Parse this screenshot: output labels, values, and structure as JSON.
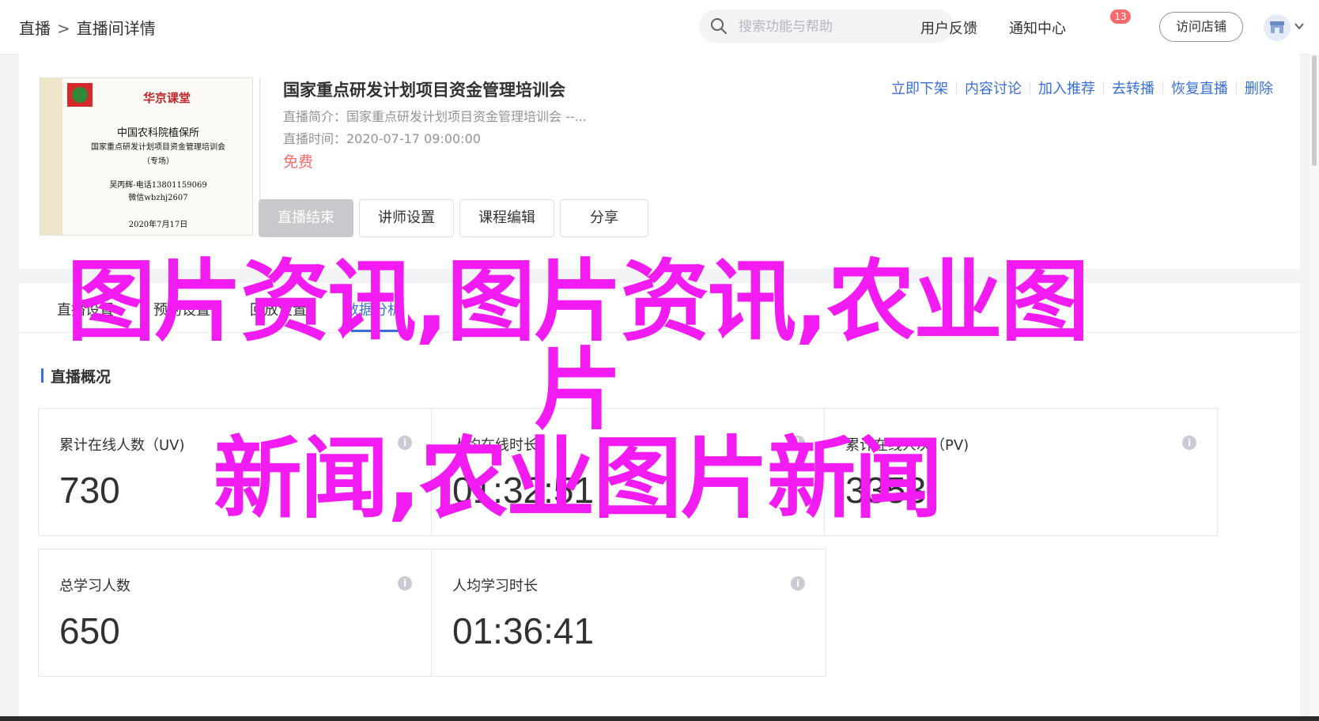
{
  "header": {
    "breadcrumb": [
      "直播",
      ">",
      "直播间详情"
    ],
    "search_placeholder": "搜索功能与帮助",
    "links": {
      "feedback": "用户反馈",
      "notifications": "通知中心",
      "notification_count": "13"
    },
    "visit_store": "访问店铺"
  },
  "course": {
    "cover": {
      "brand": "华京课堂",
      "org": "中国农科院植保所",
      "topic": "国家重点研发计划项目资金管理培训会",
      "kind": "（专场）",
      "contact1": "吴丙辉-电话13801159069",
      "contact2": "微信wbzhj2607",
      "date": "2020年7月17日"
    },
    "title": "国家重点研发计划项目资金管理培训会",
    "summary": "直播简介：国家重点研发计划项目资金管理培训会 --...",
    "time": "直播时间：2020-07-17 09:00:00",
    "price": "免费",
    "buttons": [
      "直播结束",
      "讲师设置",
      "课程编辑",
      "分享"
    ],
    "actions": [
      "立即下架",
      "内容讨论",
      "加入推荐",
      "去转播",
      "恢复直播",
      "删除"
    ]
  },
  "tabs": [
    "直播设置",
    "预约设置",
    "回放设置",
    "数据分析"
  ],
  "active_tab": "数据分析",
  "overview": {
    "title": "直播概况",
    "stats": [
      {
        "label": "累计在线人数（UV)",
        "value": "730"
      },
      {
        "label": "人均在线时长",
        "value": "01:32:51"
      },
      {
        "label": "累计在线人次（PV)",
        "value": "3353"
      },
      {
        "label": "总学习人数",
        "value": "650"
      },
      {
        "label": "人均学习时长",
        "value": "01:36:41"
      }
    ]
  },
  "watermark": {
    "line1": "图片资讯,图片资讯,农业图片",
    "line2": "新闻,农业图片新闻"
  },
  "colors": {
    "accent": "#3a6fd8",
    "price": "#f56c6c",
    "watermark": "#f21bf2"
  }
}
